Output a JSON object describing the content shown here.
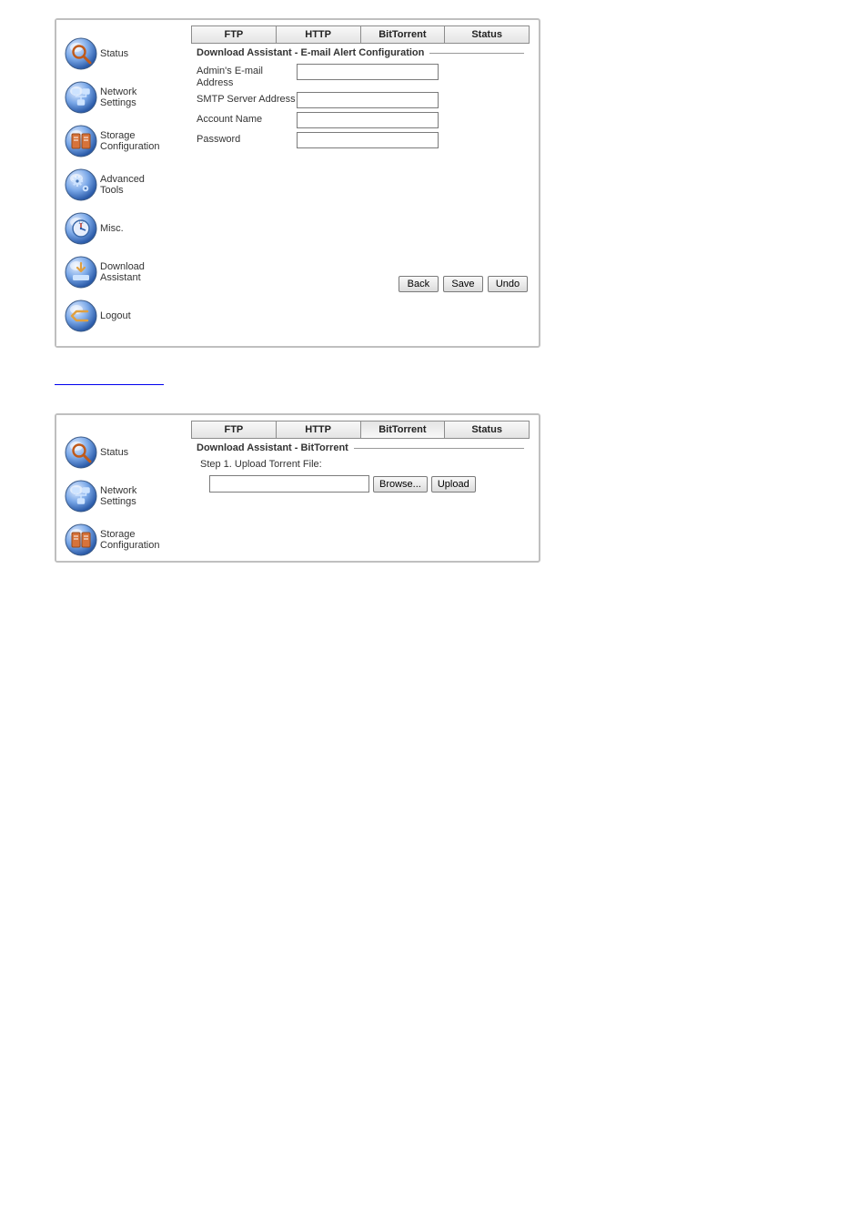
{
  "panel1": {
    "tabs": [
      {
        "label": "FTP",
        "active": false
      },
      {
        "label": "HTTP",
        "active": false
      },
      {
        "label": "BitTorrent",
        "active": false
      },
      {
        "label": "Status",
        "active": false
      }
    ],
    "legend": "Download Assistant - E-mail Alert Configuration",
    "fields": {
      "admin_email_label": "Admin's E-mail Address",
      "admin_email_value": "",
      "smtp_label": "SMTP Server Address",
      "smtp_value": "",
      "account_label": "Account Name",
      "account_value": "",
      "password_label": "Password",
      "password_value": ""
    },
    "buttons": {
      "back": "Back",
      "save": "Save",
      "undo": "Undo"
    },
    "sidebar": [
      {
        "label": "Status",
        "icon": "magnifier"
      },
      {
        "label": "Network Settings",
        "icon": "network"
      },
      {
        "label": "Storage Configuration",
        "icon": "disks"
      },
      {
        "label": "Advanced Tools",
        "icon": "gears"
      },
      {
        "label": "Misc.",
        "icon": "clock"
      },
      {
        "label": "Download Assistant",
        "icon": "download"
      },
      {
        "label": "Logout",
        "icon": "logout"
      }
    ]
  },
  "section_link_text": "",
  "panel2": {
    "tabs": [
      {
        "label": "FTP",
        "active": false
      },
      {
        "label": "HTTP",
        "active": false
      },
      {
        "label": "BitTorrent",
        "active": true
      },
      {
        "label": "Status",
        "active": false
      }
    ],
    "legend": "Download Assistant - BitTorrent",
    "step_text": "Step 1. Upload Torrent File:",
    "file_value": "",
    "buttons": {
      "browse": "Browse...",
      "upload": "Upload"
    },
    "sidebar": [
      {
        "label": "Status",
        "icon": "magnifier"
      },
      {
        "label": "Network Settings",
        "icon": "network"
      },
      {
        "label": "Storage Configuration",
        "icon": "disks"
      }
    ]
  },
  "icons": {
    "magnifier": "status-icon",
    "network": "network-icon",
    "disks": "storage-icon",
    "gears": "tools-icon",
    "clock": "misc-icon",
    "download": "download-icon",
    "logout": "logout-icon"
  }
}
